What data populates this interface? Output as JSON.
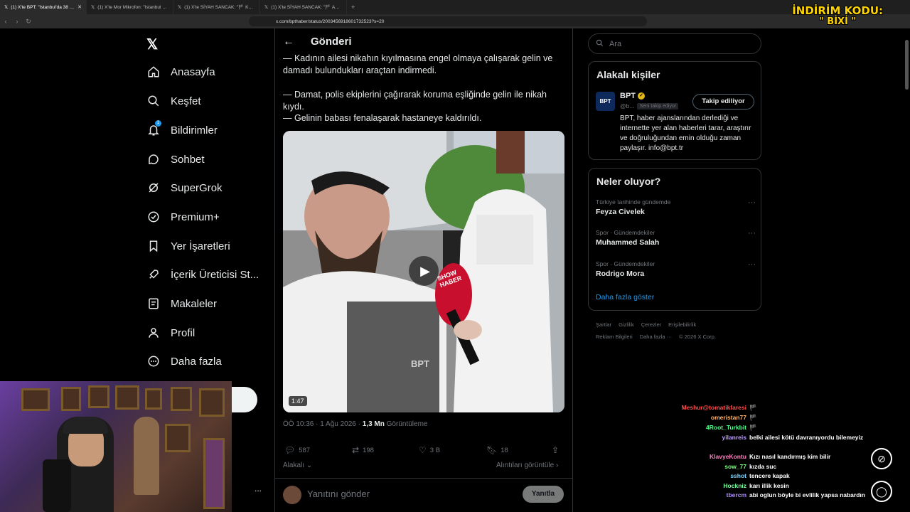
{
  "browser": {
    "tabs": [
      {
        "label": "(1) X'te BPT: \"İstanbul'da 38 yaşın",
        "active": true
      },
      {
        "label": "(1) X'te Mor Mikrofon: \"İstanbul Gün",
        "active": false
      },
      {
        "label": "(1) X'te SİYAH SANCAK: \"🏴 Kahram",
        "active": false
      },
      {
        "label": "(1) X'te SİYAH SANCAK: \"🏴 Adana'd",
        "active": false
      }
    ],
    "new_tab": "+",
    "url": "x.com/bpthaber/status/2003456918601732523?s=20"
  },
  "overlay": {
    "coupon_line1": "İNDİRİM KODU:",
    "coupon_line2": "\" BİXİ \""
  },
  "sidebar": {
    "items": [
      {
        "label": "Anasayfa",
        "icon": "home-icon"
      },
      {
        "label": "Keşfet",
        "icon": "search-icon"
      },
      {
        "label": "Bildirimler",
        "icon": "bell-icon",
        "badge": "1"
      },
      {
        "label": "Sohbet",
        "icon": "chat-icon"
      },
      {
        "label": "SuperGrok",
        "icon": "grok-icon"
      },
      {
        "label": "Premium+",
        "icon": "verified-icon"
      },
      {
        "label": "Yer İşaretleri",
        "icon": "bookmark-icon"
      },
      {
        "label": "İçerik Üreticisi St...",
        "icon": "rocket-icon"
      },
      {
        "label": "Makaleler",
        "icon": "article-icon"
      },
      {
        "label": "Profil",
        "icon": "person-icon"
      },
      {
        "label": "Daha fazla",
        "icon": "more-circle-icon"
      }
    ],
    "more_dots": "..."
  },
  "post": {
    "header_title": "Gönderi",
    "paragraphs": [
      "— Kadının ailesi nikahın kıyılmasına engel olmaya çalışarak gelin ve damadı bulundukları araçtan indirmedi.",
      "— Damat, polis ekiplerini çağırarak koruma eşliğinde gelin ile nikah kıydı.",
      "— Gelinin babası fenalaşarak hastaneye kaldırıldı."
    ],
    "video_duration": "1:47",
    "video_watermark": "BPT",
    "mic_label": "SHOW HABER",
    "timestamp": "ÖÖ 10:36 · 1 Ağu 2026 · ",
    "views_count": "1,3 Mn",
    "views_label": " Görüntüleme",
    "stats": {
      "replies": "587",
      "reposts": "198",
      "likes": "3 B",
      "bookmarks": "18"
    },
    "sort_label": "Alakalı",
    "quotes_label": "Alıntıları görüntüle",
    "reply_placeholder": "Yanıtını gönder",
    "reply_button": "Yanıtla"
  },
  "right": {
    "search_placeholder": "Ara",
    "related_title": "Alakalı kişiler",
    "related": {
      "name": "BPT",
      "handle": "@b...",
      "follows_you": "Seni takip ediyor",
      "follow_button": "Takip ediliyor",
      "bio": "BPT, haber ajanslarından derlediği ve internette yer alan haberleri tarar, araştırır ve doğruluğundan emin olduğu zaman paylaşır. info@bpt.tr",
      "logo_text": "BPT"
    },
    "trends_title": "Neler oluyor?",
    "trends": [
      {
        "context": "Türkiye tarihinde gündemde",
        "name": "Feyza Civelek"
      },
      {
        "context": "Spor · Gündemdekiler",
        "name": "Muhammed Salah"
      },
      {
        "context": "Spor · Gündemdekiler",
        "name": "Rodrigo Mora"
      }
    ],
    "show_more": "Daha fazla göster",
    "footer_row1": [
      "Şartlar",
      "Gizlilik",
      "Çerezler",
      "Erişilebilirlik"
    ],
    "footer_row2": [
      "Reklam Bilgileri",
      "Daha fazla ···",
      "© 2026 X Corp."
    ]
  },
  "chat": [
    {
      "user": "Meshur@tomatikfaresi",
      "color": "#ff4d4d",
      "msg": "🏴"
    },
    {
      "user": "omeristan77",
      "color": "#ffb36b",
      "msg": "🏴"
    },
    {
      "user": "4Root_Turkbit",
      "color": "#4dff88",
      "msg": "🏴"
    },
    {
      "user": "yilanreis",
      "color": "#c0a0ff",
      "msg": "belki ailesi kötü davranıyordu bilemeyiz"
    },
    {
      "user": "KlavyeKontu",
      "color": "#ff7fbf",
      "msg": "Kızı nasıl kandırmış kim bilir"
    },
    {
      "user": "sow_77",
      "color": "#7fff7f",
      "msg": "kızda suc"
    },
    {
      "user": "sshot",
      "color": "#7fd4ff",
      "msg": "tencere kapak"
    },
    {
      "user": "Hockniz",
      "color": "#7fff9f",
      "msg": "karı illik kesin"
    },
    {
      "user": "tbercm",
      "color": "#b08fff",
      "msg": "abi oglun böyle bi evlilik yapsa nabardın"
    }
  ]
}
